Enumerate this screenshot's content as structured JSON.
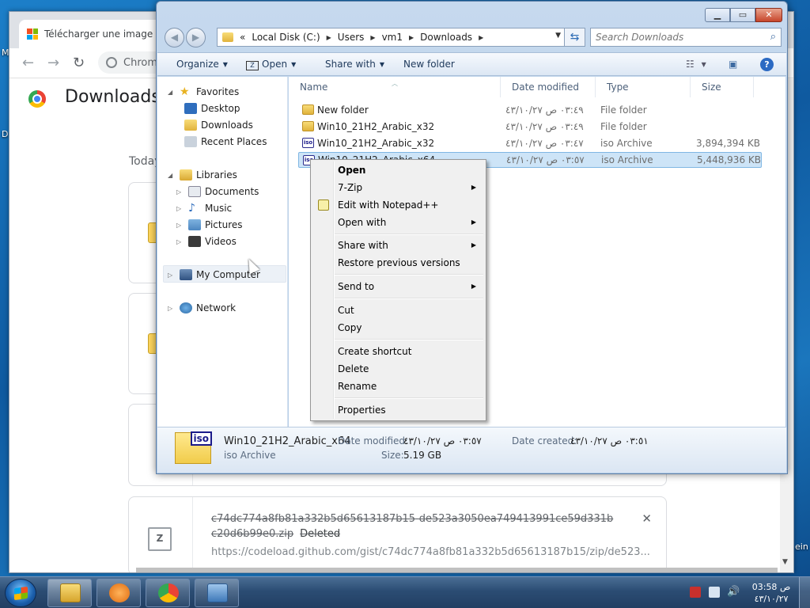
{
  "desktop": {
    "left_labels": [
      "M",
      "D"
    ],
    "right_label": "ein"
  },
  "chrome": {
    "tab_title": "Télécharger une image disque",
    "omnibox_text": "Chrom",
    "page_title": "Downloads",
    "today_label": "Today",
    "download": {
      "name": "c74dc774a8fb81a332b5d65613187b15-de523a3050ea749413991ce59d331bc20d6b99e0.zip",
      "status": "Deleted",
      "url": "https://codeload.github.com/gist/c74dc774a8fb81a332b5d65613187b15/zip/de523...",
      "close": "✕",
      "icon_text": "Z"
    }
  },
  "explorer": {
    "address": {
      "chevron": "«",
      "crumbs": [
        "Local Disk (C:)",
        "Users",
        "vm1",
        "Downloads"
      ]
    },
    "search_placeholder": "Search Downloads",
    "commands": {
      "organize": "Organize",
      "open": "Open",
      "share_with": "Share with",
      "new_folder": "New folder",
      "help": "?"
    },
    "nav": {
      "favorites": "Favorites",
      "desktop": "Desktop",
      "downloads": "Downloads",
      "recent_places": "Recent Places",
      "libraries": "Libraries",
      "documents": "Documents",
      "music": "Music",
      "pictures": "Pictures",
      "videos": "Videos",
      "my_computer": "My Computer",
      "network": "Network"
    },
    "columns": {
      "name": "Name",
      "date_modified": "Date modified",
      "type": "Type",
      "size": "Size"
    },
    "files": [
      {
        "name": "New folder",
        "date": "٠٣:٤٩ ص ٤٣/١٠/٢٧",
        "type": "File folder",
        "size": "",
        "kind": "folder"
      },
      {
        "name": "Win10_21H2_Arabic_x32",
        "date": "٠٣:٤٩ ص ٤٣/١٠/٢٧",
        "type": "File folder",
        "size": "",
        "kind": "folder"
      },
      {
        "name": "Win10_21H2_Arabic_x32",
        "date": "٠٣:٤٧ ص ٤٣/١٠/٢٧",
        "type": "iso Archive",
        "size": "3,894,394 KB",
        "kind": "iso"
      },
      {
        "name": "Win10_21H2_Arabic_x64",
        "date": "٠٣:٥٧ ص ٤٣/١٠/٢٧",
        "type": "iso Archive",
        "size": "5,448,936 KB",
        "kind": "iso",
        "selected": true
      }
    ],
    "details": {
      "name": "Win10_21H2_Arabic_x64",
      "type": "iso Archive",
      "date_modified_label": "Date modified:",
      "date_modified": "٠٣:٥٧ ص ٤٣/١٠/٢٧",
      "date_created_label": "Date created:",
      "date_created": "٠٣:٥١ ص ٤٣/١٠/٢٧",
      "size_label": "Size:",
      "size": "5.19 GB",
      "icon_text": "iso"
    }
  },
  "context_menu": {
    "open": "Open",
    "seven_zip": "7-Zip",
    "edit_notepad": "Edit with Notepad++",
    "open_with": "Open with",
    "share_with": "Share with",
    "restore": "Restore previous versions",
    "send_to": "Send to",
    "cut": "Cut",
    "copy": "Copy",
    "create_shortcut": "Create shortcut",
    "delete": "Delete",
    "rename": "Rename",
    "properties": "Properties"
  },
  "taskbar": {
    "clock_time": "03:58 ص",
    "clock_date": "٤٣/١٠/٢٧"
  }
}
